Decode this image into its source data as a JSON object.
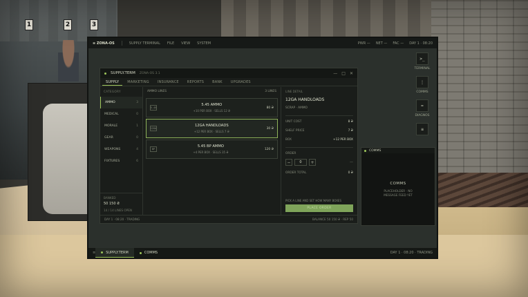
{
  "os": {
    "logo": "≡ ZONA-OS",
    "app": "SUPPLY TERMINAL",
    "menu": [
      "FILE",
      "VIEW",
      "SYSTEM"
    ],
    "status_right": [
      "PWR —",
      "NET —",
      "FAC —",
      "DAY 1 · 08:20"
    ]
  },
  "desktop_icons": [
    {
      "glyph": ">_",
      "label": "TERMINAL",
      "icon": "terminal-icon"
    },
    {
      "glyph": "⋮",
      "label": "COMMS",
      "icon": "comms-icon"
    },
    {
      "glyph": "=",
      "label": "DIAGNOS",
      "icon": "diagnostics-icon"
    },
    {
      "glyph": "≡",
      "label": "",
      "icon": "settings-icon"
    }
  ],
  "window": {
    "title": "SUPPLY.TERM",
    "version": "ZONA-OS 3.1",
    "controls": [
      "—",
      "□",
      "✕"
    ],
    "tabs": [
      "SUPPLY",
      "MARKETING",
      "INSURANCE",
      "REPORTS",
      "BANK",
      "UPGRADES"
    ],
    "active_tab": 0,
    "categories_header": "CATEGORY",
    "categories": [
      {
        "label": "AMMO",
        "count": "3"
      },
      {
        "label": "MEDICAL",
        "count": "0"
      },
      {
        "label": "MORALE",
        "count": "1"
      },
      {
        "label": "GEAR",
        "count": "0"
      },
      {
        "label": "WEAPONS",
        "count": "4"
      },
      {
        "label": "FIXTURES",
        "count": "6"
      }
    ],
    "bank": {
      "header": "BANKED",
      "value": "50 150 ₴",
      "sub": "14 / 14 LINES OPEN"
    },
    "lines_header": "AMMO LINES",
    "lines_count": "3 LINES",
    "lines": [
      {
        "badge": "5.45",
        "name": "5.45 AMMO",
        "meta": "+10 PER BOX · SELLS 12 ₴",
        "price": "80 ₴"
      },
      {
        "badge": "12GA",
        "name": "12GA HANDLOADS",
        "meta": "+12 PER BOX · SELLS 7 ₴",
        "price": "30 ₴"
      },
      {
        "badge": "BP",
        "name": "5.45 BP AMMO",
        "meta": "+4 PER BOX · SELLS 35 ₴",
        "price": "120 ₴"
      }
    ],
    "detail": {
      "header": "LINE DETAIL",
      "title": "12GA HANDLOADS",
      "sub": "SCRAP · AMMO",
      "kv": [
        {
          "k": "UNIT COST",
          "v": "8 ₴"
        },
        {
          "k": "SHELF PRICE",
          "v": "7 ₴"
        },
        {
          "k": "BOX",
          "v": "+12 PER BOX"
        }
      ],
      "order_header": "ORDER",
      "qty": "0",
      "order_total_label": "ORDER TOTAL",
      "order_total": "0 ₴",
      "hint": "PICK A LINE AND SET HOW MANY BOXES",
      "place_label": "PLACE ORDER"
    },
    "status_left": "DAY 1 · 08:20 · TRADING",
    "status_right": "BALANCE 50 150 ₴ · REP 50"
  },
  "comms": {
    "title": "COMMS",
    "heading": "COMMS",
    "placeholder": "PLACEHOLDER · NO MESSAGE FEED YET"
  },
  "taskbar": {
    "menu_glyph": "≡",
    "items": [
      "SUPPLY.TERM",
      "COMMS"
    ],
    "status": "DAY 1 · 08:20 · TRADING"
  },
  "colors": {
    "accent": "#9ec65b",
    "place_button": "#7fa45a"
  }
}
